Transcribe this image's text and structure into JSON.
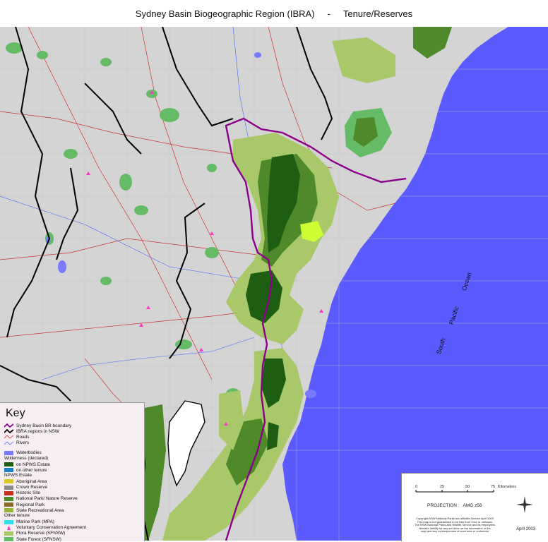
{
  "title": {
    "region": "Sydney Basin Biogeographic Region (IBRA)",
    "separator": "-",
    "subject": "Tenure/Reserves"
  },
  "ocean_labels": [
    "South",
    "Pacific",
    "Ocean"
  ],
  "key": {
    "heading": "Key",
    "lines": [
      {
        "label": "Sydney Basin BR boundary",
        "color": "#8b008b"
      },
      {
        "label": "IBRA regions in NSW",
        "color": "#000000"
      },
      {
        "label": "Roads",
        "color": "#cc3333"
      },
      {
        "label": "Rivers",
        "color": "#4466ff"
      }
    ],
    "waterbodies": {
      "label": "Waterbodies",
      "color": "#7a7aff"
    },
    "wilderness_heading": "Wilderness (declared)",
    "wilderness": [
      {
        "label": "on NPWS Estate",
        "color": "#1e5e12"
      },
      {
        "label": "on other tenure",
        "color": "#1e7fc8"
      }
    ],
    "npws_heading": "NPWS Estate",
    "npws": [
      {
        "label": "Aboriginal Area",
        "color": "#d8c92a"
      },
      {
        "label": "Crown Reserve",
        "color": "#8a8a8a"
      },
      {
        "label": "Historic Site",
        "color": "#c4321e"
      },
      {
        "label": "National Park/ Nature Reserve",
        "color": "#4f8a2a"
      },
      {
        "label": "Regional Park",
        "color": "#8a6a2a"
      },
      {
        "label": "State Recreational Area",
        "color": "#96b43a"
      }
    ],
    "other_heading": "Other tenure",
    "other": [
      {
        "label": "Marine Park (MPA)",
        "color": "#33e0f0"
      },
      {
        "label": "Voluntary Conservation Agreement",
        "color": "#ff33cc"
      },
      {
        "label": "Flora Reserve (SFNSW)",
        "color": "#a8c86a"
      },
      {
        "label": "State Forest (SFNSW)",
        "color": "#66bb66"
      }
    ]
  },
  "scale": {
    "ticks": [
      "0",
      "25",
      "50",
      "75"
    ],
    "unit": "Kilometres"
  },
  "projection": "PROJECTION :   AMG z56",
  "copyright": [
    "Copyright NSW National Parks and Wildlife Service April 2003",
    "This map is not guaranteed to be free from error or omission",
    "The NSW National Parks and Wildlife Service and its employees",
    "disclaim liability for any act done on the information in the",
    "map and any consequences of such acts or omissions"
  ],
  "date": "April 2003",
  "colors": {
    "land": "#d4d4d4",
    "ocean": "#5a5aff",
    "wilderness": "#1e5e12",
    "flora": "#a8c86a",
    "forest": "#66bb66",
    "park": "#4f8a2a",
    "basin": "#8b008b"
  }
}
